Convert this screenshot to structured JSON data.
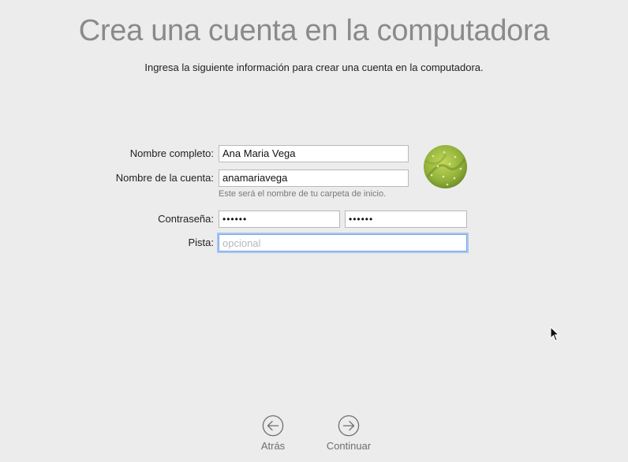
{
  "header": {
    "title": "Crea una cuenta en la computadora",
    "subtitle": "Ingresa la siguiente información para crear una cuenta en la computadora."
  },
  "form": {
    "full_name_label": "Nombre completo:",
    "full_name_value": "Ana Maria Vega",
    "account_name_label": "Nombre de la cuenta:",
    "account_name_value": "anamariavega",
    "account_name_hint": "Este será el nombre de tu carpeta de inicio.",
    "password_label": "Contraseña:",
    "password_value": "••••••",
    "password_verify_value": "••••••",
    "hint_label": "Pista:",
    "hint_placeholder": "opcional"
  },
  "avatar": {
    "icon": "cactus-avatar-icon",
    "accent": "#9bb83a"
  },
  "nav": {
    "back_label": "Atrás",
    "continue_label": "Continuar"
  },
  "colors": {
    "focus_ring": "#7aa7e8",
    "background": "#ececec",
    "title": "#8a8a8a"
  }
}
